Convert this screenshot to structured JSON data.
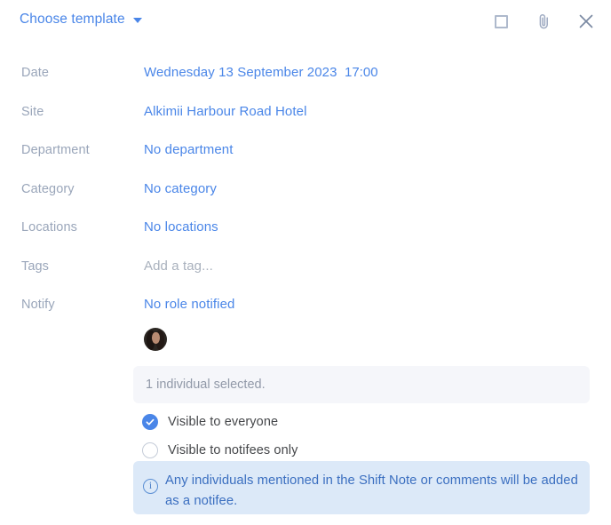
{
  "header": {
    "template_picker_label": "Choose template",
    "caret_icon": "chevron-down-icon",
    "actions": [
      {
        "name": "expand-square-icon",
        "label": ""
      },
      {
        "name": "attachment-icon",
        "label": ""
      },
      {
        "name": "close-icon",
        "label": ""
      }
    ]
  },
  "fields": [
    {
      "label": "Date",
      "value": "Wednesday 13 September 2023",
      "time": "17:00",
      "placeholder": false
    },
    {
      "label": "Site",
      "value": "Alkimii Harbour Road Hotel",
      "time": "",
      "placeholder": false
    },
    {
      "label": "Department",
      "value": "No department",
      "time": "",
      "placeholder": false
    },
    {
      "label": "Category",
      "value": "No category",
      "time": "",
      "placeholder": false
    },
    {
      "label": "Locations",
      "value": "No locations",
      "time": "",
      "placeholder": false
    },
    {
      "label": "Tags",
      "value": "Add a tag...",
      "time": "",
      "placeholder": true
    },
    {
      "label": "Notify",
      "value": "No role notified",
      "time": "",
      "placeholder": false
    }
  ],
  "notify": {
    "avatars": [
      {
        "name": "individual-avatar",
        "alt": ""
      }
    ],
    "selected_summary": "1 individual selected.",
    "visibility_options": [
      {
        "label": "Visible to everyone",
        "selected": true
      },
      {
        "label": "Visible to notifees only",
        "selected": false
      }
    ],
    "info_banner": {
      "icon": "info-icon",
      "text": "Any individuals mentioned in the Shift Note or comments will be added as a notifee."
    }
  },
  "colors": {
    "accent_blue": "#4a86e8",
    "label_grey": "#9aa6ba",
    "placeholder_grey": "#a9b1bd",
    "panel_grey": "#f5f6fa",
    "info_bg": "#dce9f8",
    "info_text": "#3b6fc0"
  }
}
